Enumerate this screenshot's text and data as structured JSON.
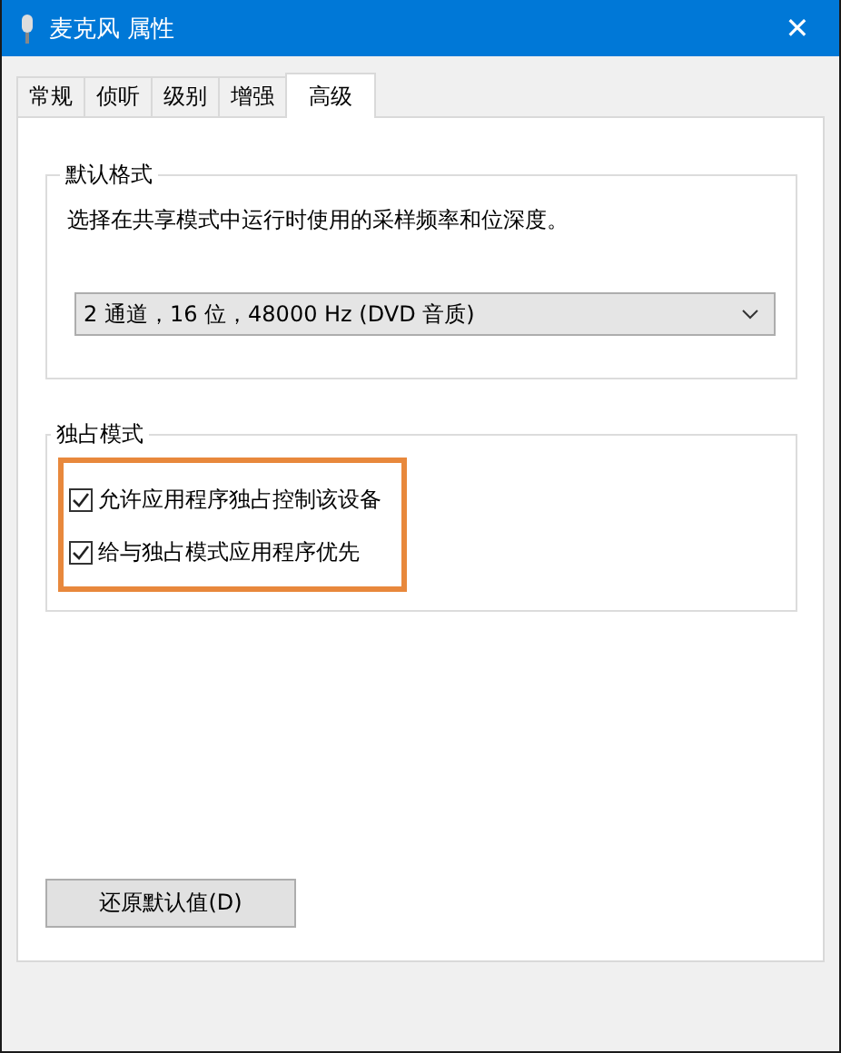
{
  "window": {
    "title": "麦克风 属性",
    "close": "✕"
  },
  "tabs": [
    {
      "label": "常规",
      "selected": false
    },
    {
      "label": "侦听",
      "selected": false
    },
    {
      "label": "级别",
      "selected": false
    },
    {
      "label": "增强",
      "selected": false
    },
    {
      "label": "高级",
      "selected": true
    }
  ],
  "default_format": {
    "title": "默认格式",
    "description": "选择在共享模式中运行时使用的采样频率和位深度。",
    "value": "2 通道，16 位，48000 Hz (DVD 音质)"
  },
  "exclusive_mode": {
    "title": "独占模式",
    "options": [
      {
        "label": "允许应用程序独占控制该设备",
        "checked": true
      },
      {
        "label": "给与独占模式应用程序优先",
        "checked": true
      }
    ]
  },
  "restore_button": "还原默认值(D)"
}
